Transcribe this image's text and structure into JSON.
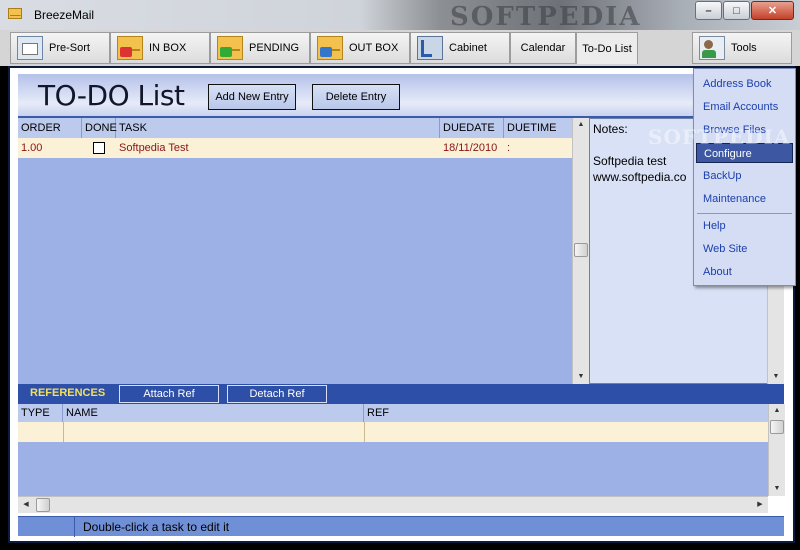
{
  "window": {
    "title": "BreezeMail",
    "watermark": "SOFTPEDIA",
    "buttons": {
      "minimize": "–",
      "maximize": "□",
      "close": "✕"
    }
  },
  "toolbar": {
    "buttons": [
      {
        "label": "Pre-Sort",
        "icon": "presort-icon"
      },
      {
        "label": "IN BOX",
        "icon": "inbox-envelope-icon"
      },
      {
        "label": "PENDING",
        "icon": "pending-envelope-icon"
      },
      {
        "label": "OUT BOX",
        "icon": "outbox-envelope-icon"
      },
      {
        "label": "Cabinet",
        "icon": "cabinet-icon"
      },
      {
        "label": "Calendar"
      },
      {
        "label": "To-Do List",
        "active": true
      },
      {
        "label": "Tools",
        "icon": "tools-user-icon"
      }
    ]
  },
  "todo": {
    "title": "TO-DO List",
    "add_label": "Add New Entry",
    "delete_label": "Delete Entry",
    "columns": [
      "ORDER",
      "DONE",
      "TASK",
      "DUEDATE",
      "DUETIME"
    ],
    "rows": [
      {
        "order": "1.00",
        "done": false,
        "task": "Softpedia Test",
        "duedate": "18/11/2010",
        "duetime": ":"
      }
    ]
  },
  "notes": {
    "label": "Notes:",
    "text": "Softpedia test\nwww.softpedia.co"
  },
  "references": {
    "title": "REFERENCES",
    "attach_label": "Attach Ref",
    "detach_label": "Detach Ref",
    "columns": [
      "TYPE",
      "NAME",
      "REF"
    ]
  },
  "status": {
    "text": "Double-click a task to edit it"
  },
  "tools_menu": {
    "watermark": "SOFTPEDIA",
    "items": [
      "Address Book",
      "Email Accounts",
      "Browse Files",
      "Configure",
      "BackUp",
      "Maintenance",
      "Help",
      "Web Site",
      "About"
    ],
    "selected": "Configure"
  },
  "colors": {
    "accent": "#2d4fa8",
    "grid_bg": "#9eb1e6",
    "row_bg": "#fbf1d7",
    "task_text": "#8b1414",
    "menu_text": "#1b3fae"
  }
}
